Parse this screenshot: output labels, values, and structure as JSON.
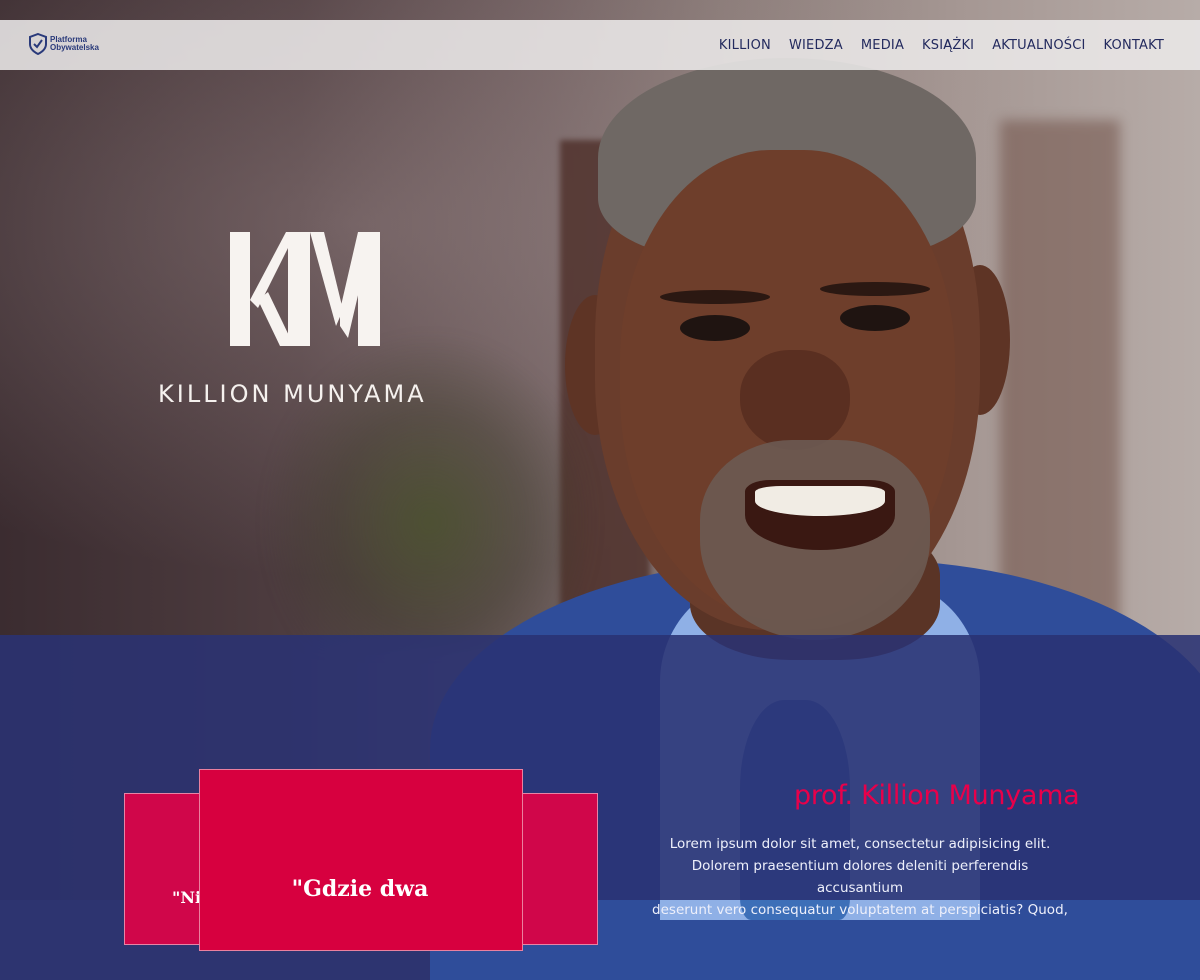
{
  "navbar": {
    "brand_line1": "Platforma",
    "brand_line2": "Obywatelska",
    "items": [
      {
        "label": "KILLION"
      },
      {
        "label": "WIEDZA"
      },
      {
        "label": "MEDIA"
      },
      {
        "label": "KSIĄŻKI"
      },
      {
        "label": "AKTUALNOŚCI"
      },
      {
        "label": "KONTAKT"
      }
    ]
  },
  "hero": {
    "logo_text": "KILLION MUNYAMA"
  },
  "quote": {
    "front_text": "\"Gdzie dwa",
    "back_text": "\"Ni"
  },
  "bio": {
    "name": "prof. Killion Munyama",
    "text_lines": [
      "Lorem ipsum dolor sit amet, consectetur adipisicing elit.",
      "Dolorem praesentium dolores deleniti perferendis accusantium",
      "deserunt vero consequatur voluptatem at perspiciatis? Quod,"
    ]
  },
  "colors": {
    "accent": "#e8004a",
    "card": "#d7003f",
    "band": "#2a3273",
    "nav_text": "#232a5e"
  }
}
